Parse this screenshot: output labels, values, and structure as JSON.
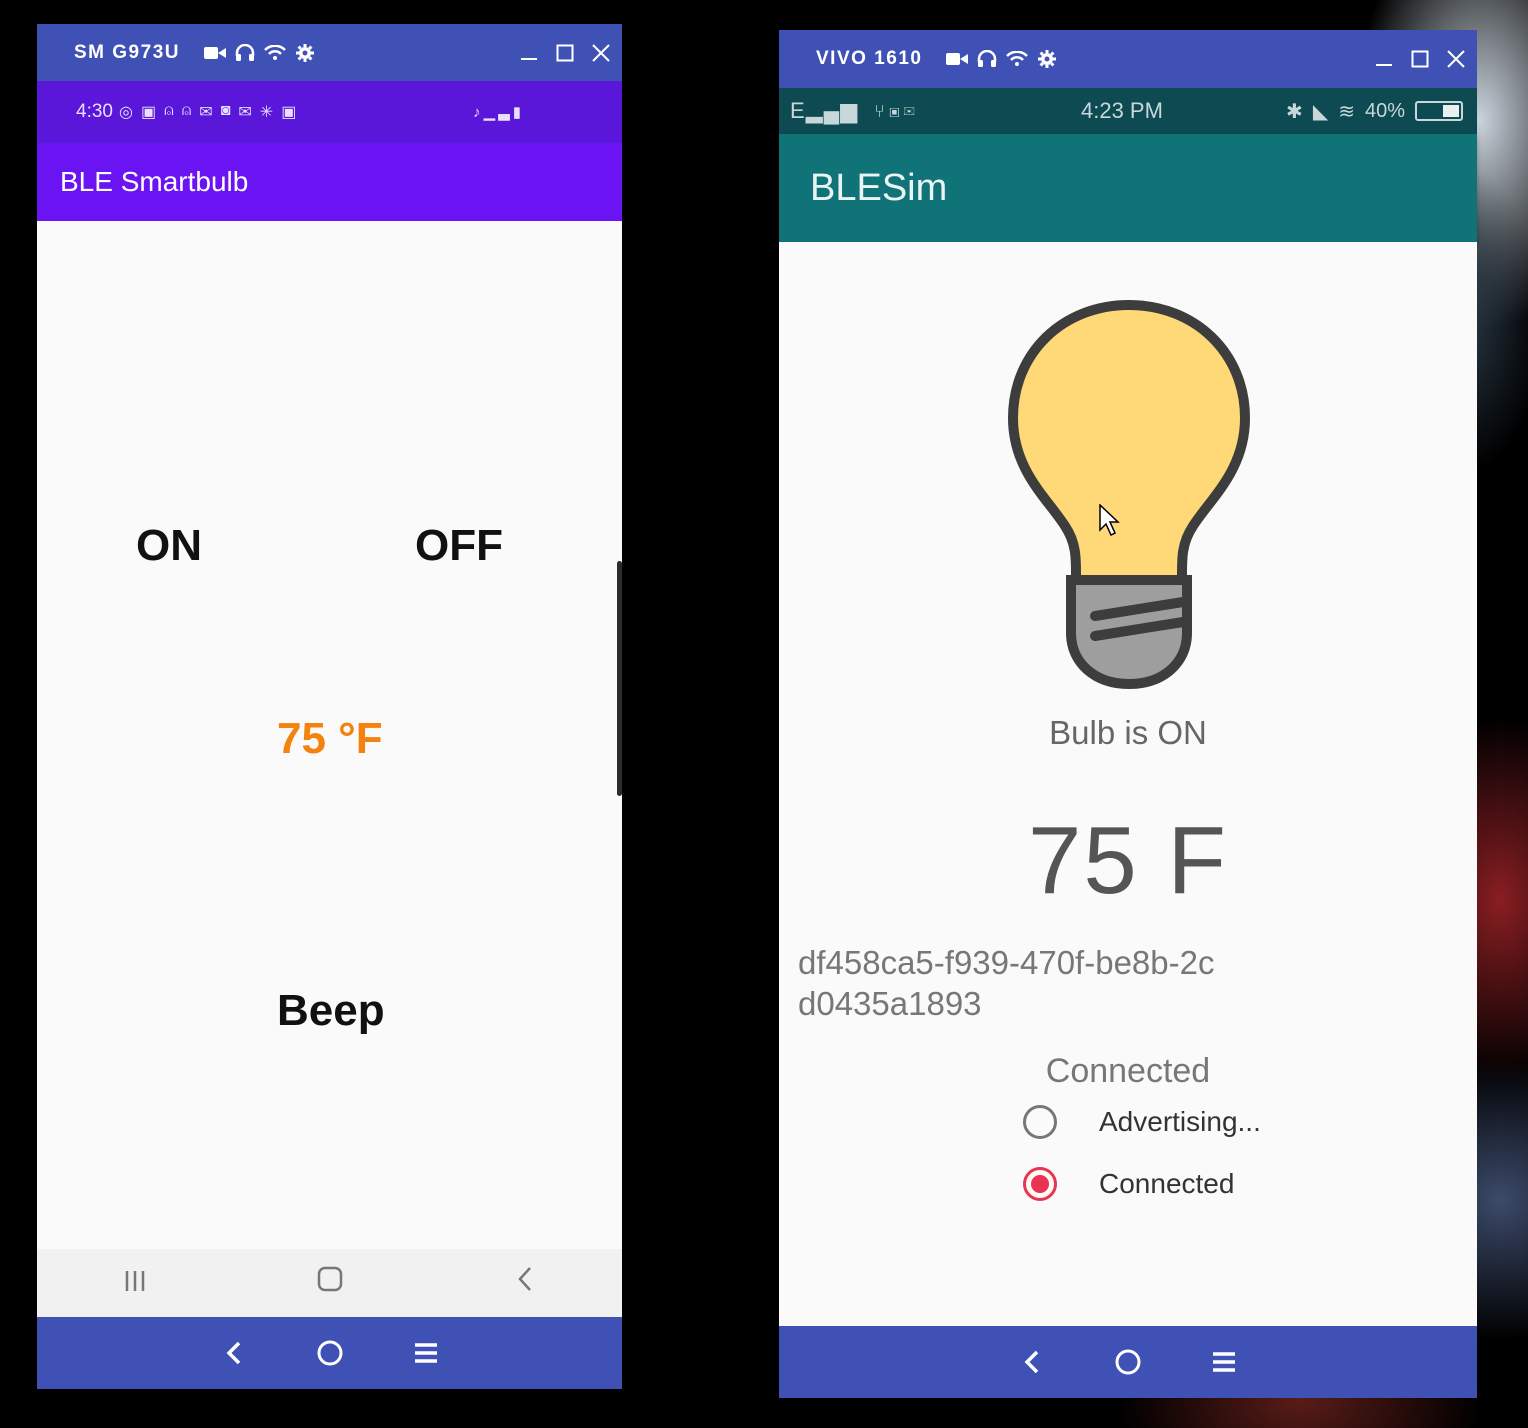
{
  "left_window": {
    "title": "SM G973U",
    "status_bar": {
      "time": "4:30",
      "notification_icons": [
        "whatsapp-icon",
        "linkedin-icon",
        "person-icon",
        "person-icon",
        "gmail-icon",
        "instagram-icon",
        "mail-icon",
        "walmart-icon",
        "linkedin-icon"
      ],
      "system_icons": [
        "mute-icon",
        "signal-icon",
        "battery-icon"
      ]
    },
    "app_title": "BLE Smartbulb",
    "buttons": {
      "on": "ON",
      "off": "OFF",
      "beep": "Beep"
    },
    "temperature": "75 °F",
    "accent_color": "#f4820e",
    "appbar_color": "#6a14f4"
  },
  "right_window": {
    "title": "VIVO 1610",
    "status_bar": {
      "signal": "E",
      "time": "4:23 PM",
      "battery": "40%"
    },
    "app_title": "BLESim",
    "bulb_color": "#ffd877",
    "bulb_status": "Bulb is ON",
    "temperature": "75 F",
    "uuid": "df458ca5-f939-470f-be8b-2cd0435a1893",
    "connection_status": "Connected",
    "radio_options": [
      {
        "label": "Advertising...",
        "checked": false
      },
      {
        "label": "Connected",
        "checked": true
      }
    ],
    "appbar_color": "#0f7378",
    "radio_accent": "#e8344e"
  },
  "window_titlebar_color": "#3f51b5"
}
